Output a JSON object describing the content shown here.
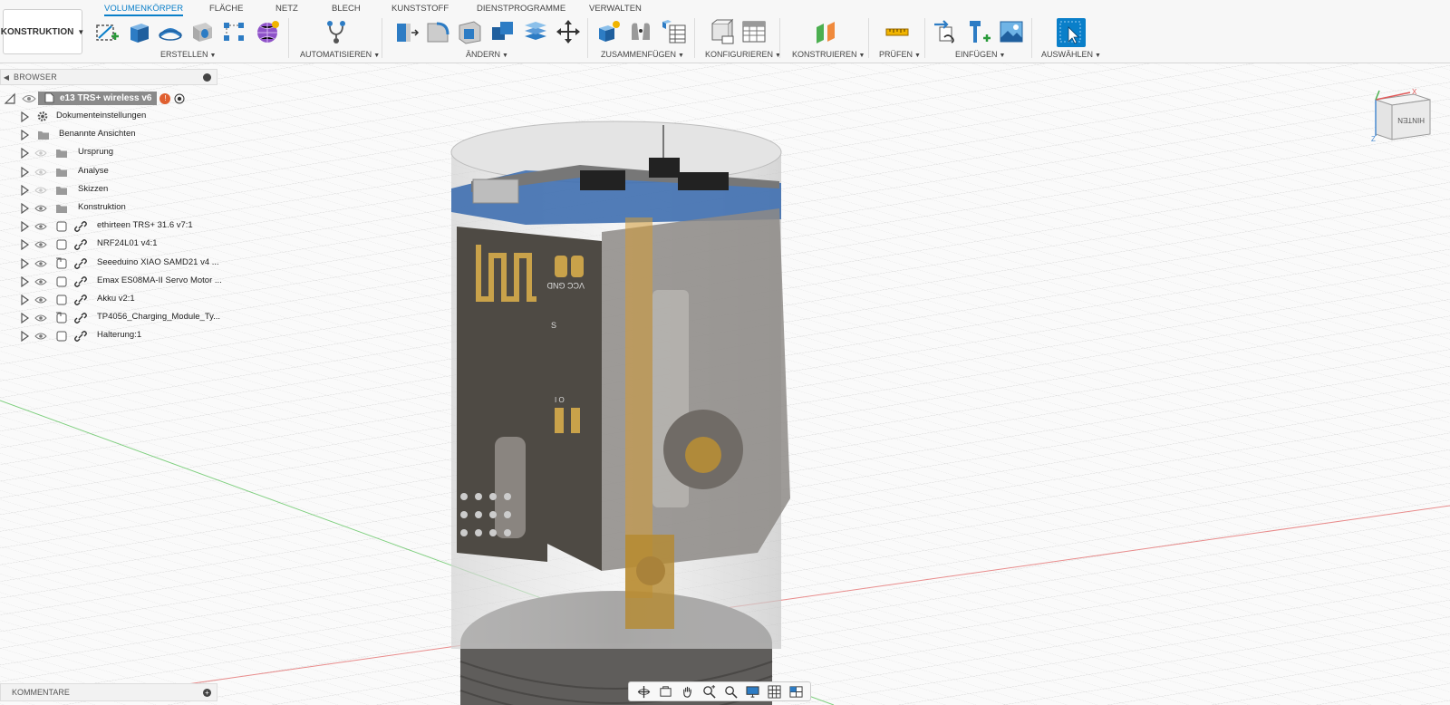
{
  "workspace": {
    "label": "KONSTRUKTION"
  },
  "tabs": [
    {
      "label": "VOLUMENKÖRPER",
      "active": true
    },
    {
      "label": "FLÄCHE"
    },
    {
      "label": "NETZ"
    },
    {
      "label": "BLECH"
    },
    {
      "label": "KUNSTSTOFF"
    },
    {
      "label": "DIENSTPROGRAMME"
    },
    {
      "label": "VERWALTEN"
    }
  ],
  "groups": {
    "erstellen": "ERSTELLEN",
    "automatisieren": "AUTOMATISIEREN",
    "aendern": "ÄNDERN",
    "zusammenfuegen": "ZUSAMMENFÜGEN",
    "konfigurieren": "KONFIGURIEREN",
    "konstruieren": "KONSTRUIEREN",
    "pruefen": "PRÜFEN",
    "einfuegen": "EINFÜGEN",
    "auswaehlen": "AUSWÄHLEN"
  },
  "browser": {
    "title": "BROWSER",
    "root": "e13 TRS+ wireless v6",
    "items": [
      {
        "label": "Dokumenteinstellungen",
        "icon": "gear-icon"
      },
      {
        "label": "Benannte Ansichten",
        "icon": "folder-icon"
      },
      {
        "label": "Ursprung",
        "icon": "folder-icon"
      },
      {
        "label": "Analyse",
        "icon": "folder-icon"
      },
      {
        "label": "Skizzen",
        "icon": "folder-icon"
      },
      {
        "label": "Konstruktion",
        "icon": "folder-icon"
      },
      {
        "label": "ethirteen TRS+ 31.6 v7:1",
        "icon": "component-icon"
      },
      {
        "label": "NRF24L01 v4:1",
        "icon": "component-icon"
      },
      {
        "label": "Seeeduino XIAO SAMD21 v4 ...",
        "icon": "component-icon"
      },
      {
        "label": "Emax ES08MA-II Servo Motor ...",
        "icon": "component-icon"
      },
      {
        "label": "Akku v2:1",
        "icon": "component-icon"
      },
      {
        "label": "TP4056_Charging_Module_Ty...",
        "icon": "component-icon"
      },
      {
        "label": "Halterung:1",
        "icon": "component-icon"
      }
    ]
  },
  "comments": {
    "title": "KOMMENTARE"
  },
  "viewcube": {
    "face_label": "HINTEN",
    "axis_x": "X",
    "axis_z": "Z"
  },
  "pcb": {
    "silk_top": "VCC GND",
    "silk_s": "S",
    "silk_io": "I O"
  },
  "colors": {
    "accent": "#0a7fc9",
    "root_bg": "#8a8a8a",
    "pcb_blue": "#3f6fb0",
    "brass": "#d49a35"
  }
}
